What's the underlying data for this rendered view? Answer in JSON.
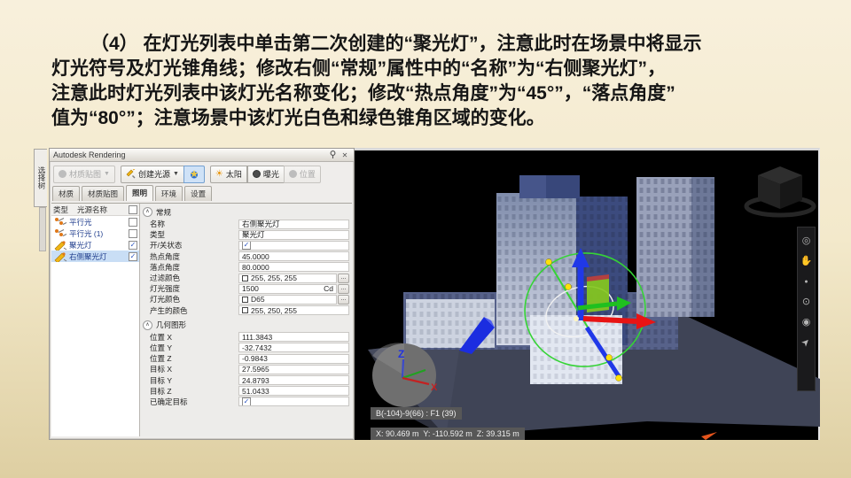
{
  "slide": {
    "title_lines": [
      "（4） 在灯光列表中单击第二次创建的“聚光灯”，注意此时在场景中将显示",
      "灯光符号及灯光锥角线；修改右侧“常规”属性中的“名称”为“右侧聚光灯”，",
      "注意此时灯光列表中该灯光名称变化；修改“热点角度”为“45°”，“落点角度”",
      "值为“80°”；注意场景中该灯光白色和绿色锥角区域的变化。"
    ]
  },
  "palette": {
    "window_title": "Autodesk Rendering",
    "selection_tree_tab": "选择树",
    "toolbar": {
      "material_map": "材质贴图",
      "create_light": "创建光源",
      "sun": "太阳",
      "exposure": "曝光",
      "location": "位置"
    },
    "tabs": [
      {
        "label": "材质"
      },
      {
        "label": "材质贴图"
      },
      {
        "label": "照明"
      },
      {
        "label": "环境"
      },
      {
        "label": "设置"
      }
    ],
    "light_list": {
      "headers": {
        "type": "类型",
        "name": "光源名称"
      },
      "rows": [
        {
          "name": "平行光",
          "checked": false
        },
        {
          "name": "平行光 (1)",
          "checked": false
        },
        {
          "name": "聚光灯",
          "checked": true
        },
        {
          "name": "右侧聚光灯",
          "checked": true,
          "selected": true
        }
      ]
    },
    "properties": {
      "general": {
        "header": "常规",
        "rows": [
          {
            "label": "名称",
            "value": "右侧聚光灯"
          },
          {
            "label": "类型",
            "value": "聚光灯"
          },
          {
            "label": "开/关状态",
            "value": ""
          },
          {
            "label": "热点角度",
            "value": "45.0000"
          },
          {
            "label": "落点角度",
            "value": "80.0000"
          },
          {
            "label": "过滤颜色",
            "value": "255, 255, 255"
          },
          {
            "label": "灯光强度",
            "value": "1500",
            "unit": "Cd"
          },
          {
            "label": "灯光颜色",
            "value": "D65"
          },
          {
            "label": "产生的颜色",
            "value": "255, 250, 255"
          }
        ]
      },
      "geometry": {
        "header": "几何图形",
        "rows": [
          {
            "label": "位置 X",
            "value": "111.3843"
          },
          {
            "label": "位置 Y",
            "value": "-32.7432"
          },
          {
            "label": "位置 Z",
            "value": "-0.9843"
          },
          {
            "label": "目标 X",
            "value": "27.5965"
          },
          {
            "label": "目标 Y",
            "value": "24.8793"
          },
          {
            "label": "目标 Z",
            "value": "51.0433"
          },
          {
            "label": "已确定目标",
            "value": ""
          }
        ]
      }
    }
  },
  "viewport": {
    "overlay_label": "B(-104)-9(66) : F1 (39)",
    "coords_label": "X: 90.469 m  Y: -110.592 m  Z: 39.315 m",
    "axis_labels": {
      "x": "X",
      "z": "Z"
    }
  },
  "icons": {
    "close": "✕",
    "dropdown": "▼",
    "browse": "...",
    "check": "✓",
    "sun": "☀",
    "collapse": "▲",
    "steering": "◎",
    "hand": "✋",
    "zoom_dot": "●",
    "orbit": "⊙",
    "look": "◉",
    "cursor": "➤"
  },
  "colors": {
    "slide_bg": "#f3e9cb",
    "selection_highlight": "#c9def5",
    "gizmo_green": "#35d435",
    "gizmo_white": "#f2f2f2",
    "axis_blue": "#2038e8",
    "axis_red": "#e81414",
    "axis_green": "#1fc01f",
    "marker_yellow": "#ffe00a",
    "ground_plane": "#3f4456",
    "viewport_bg": "#000000"
  }
}
